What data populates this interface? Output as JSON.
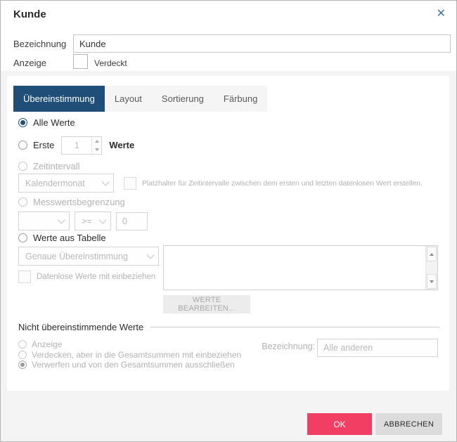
{
  "dialog": {
    "title": "Kunde",
    "close_icon": "✕"
  },
  "form": {
    "bezeichnung_label": "Bezeichnung",
    "bezeichnung_value": "Kunde",
    "anzeige_label": "Anzeige",
    "verdeckt_label": "Verdeckt"
  },
  "tabs": [
    {
      "label": "Übereinstimmung",
      "active": true
    },
    {
      "label": "Layout",
      "active": false
    },
    {
      "label": "Sortierung",
      "active": false
    },
    {
      "label": "Färbung",
      "active": false
    }
  ],
  "match": {
    "alle_werte_label": "Alle Werte",
    "erste_label": "Erste",
    "erste_value": "1",
    "werte_label": "Werte",
    "zeitintervall_label": "Zeitintervall",
    "interval_value": "Kalendermonat",
    "platzhalter_label": "Platzhalter für Zeitintervalle zwischen dem ersten und letzten datenlosen Wert erstellen.",
    "messwertsbegrenzung_label": "Messwertsbegrenzung",
    "measure_value": "",
    "operator_value": ">=",
    "limit_value": "0",
    "werte_aus_tabelle_label": "Werte aus Tabelle",
    "match_mode_value": "Genaue Übereinstimmung",
    "datenlose_label": "Datenlose Werte mit einbeziehen",
    "werte_bearbeiten_label": "WERTE BEARBEITEN...",
    "selected_option": "Alle Werte"
  },
  "unmatched": {
    "header": "Nicht übereinstimmende Werte",
    "options": [
      {
        "label": "Anzeige"
      },
      {
        "label": "Verdecken, aber in die Gesamtsummen mit einbeziehen"
      },
      {
        "label": "Verwerfen und von den Gesamtsummen ausschließen"
      }
    ],
    "selected_option": "Verwerfen und von den Gesamtsummen ausschließen",
    "bezeichnung_label": "Bezeichnung:",
    "bezeichnung_value": "Alle anderen"
  },
  "footer": {
    "ok_label": "OK",
    "cancel_label": "ABBRECHEN"
  },
  "colors": {
    "accent_tab": "#1f4e79",
    "ok_button": "#f33e63",
    "close_icon": "#41719c",
    "body_background": "#f4f4f4",
    "disabled_text": "#b2b2b2"
  }
}
